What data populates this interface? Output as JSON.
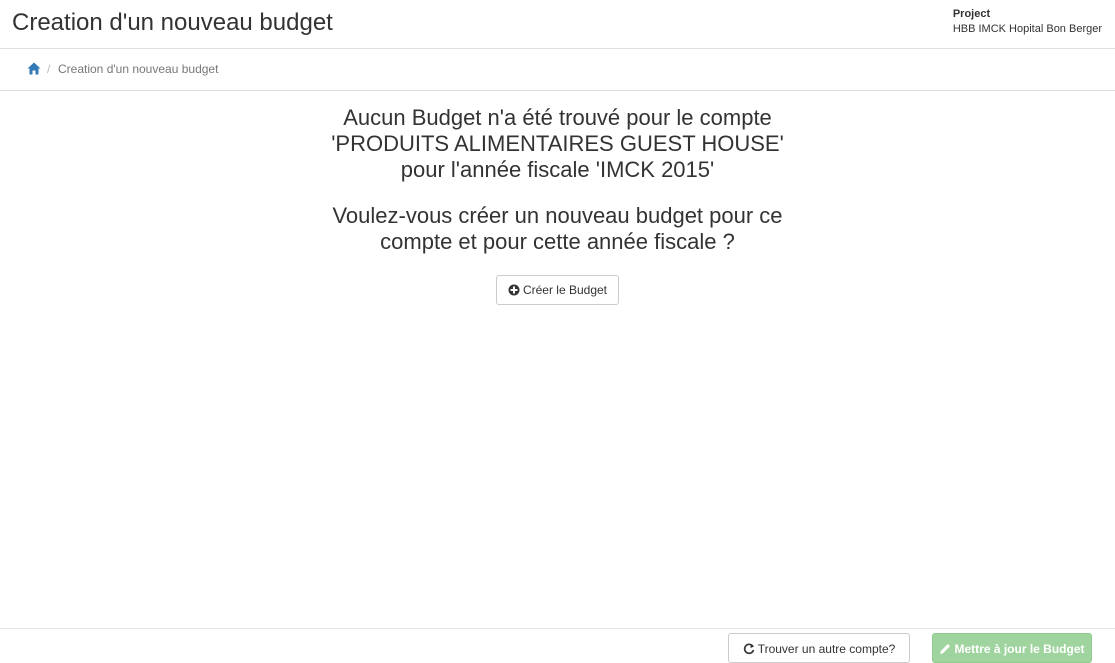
{
  "header": {
    "title": "Creation d'un nouveau budget",
    "project_label": "Project",
    "project_name": "HBB IMCK Hopital Bon Berger"
  },
  "breadcrumb": {
    "home_icon": "home-icon",
    "separator": "/",
    "current": "Creation d'un nouveau budget"
  },
  "message": {
    "line1": "Aucun Budget n'a été trouvé pour le compte",
    "line2": "'PRODUITS ALIMENTAIRES GUEST HOUSE'",
    "line3": "pour l'année fiscale 'IMCK 2015'",
    "question_line1": "Voulez-vous créer un nouveau budget pour ce",
    "question_line2": "compte et pour cette année fiscale ?"
  },
  "actions": {
    "create_label": "Créer le Budget",
    "create_icon": "plus-circle-icon",
    "find_label": "Trouver un autre compte?",
    "find_icon": "refresh-icon",
    "update_label": "Mettre à jour le Budget",
    "update_icon": "pencil-icon"
  },
  "colors": {
    "accent": "#337ab7",
    "update_button": "#9fd49f",
    "text": "#333333",
    "muted": "#777777"
  }
}
